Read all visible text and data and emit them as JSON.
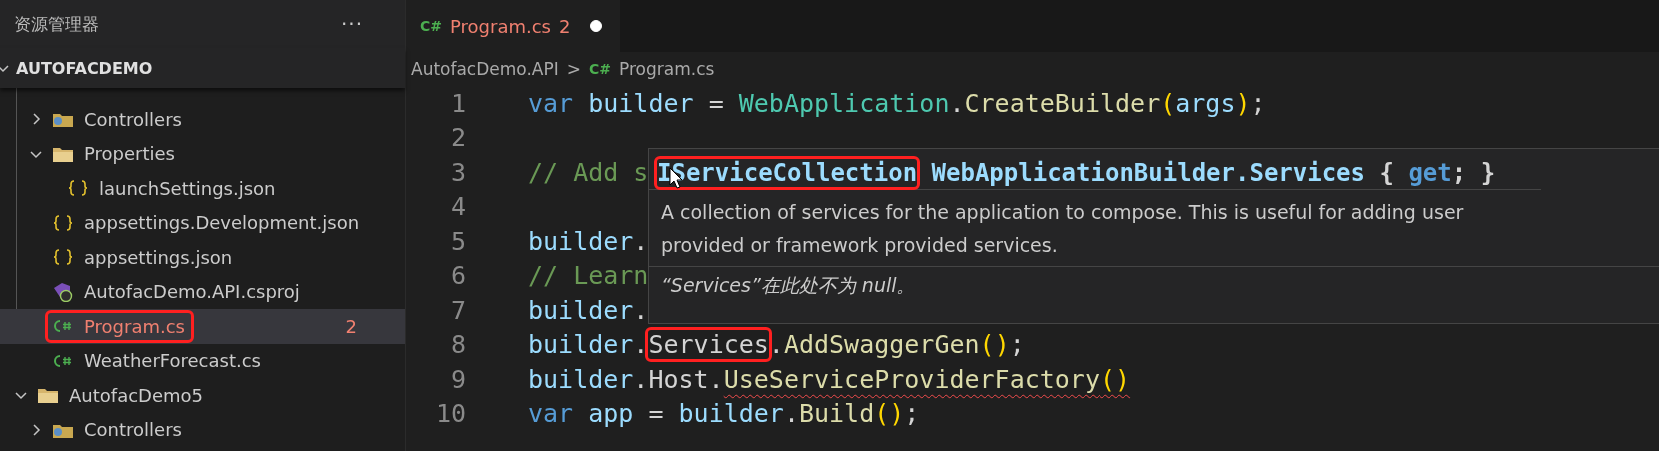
{
  "sidebar": {
    "title": "资源管理器",
    "more": "···",
    "root": {
      "label": "AUTOFACDEMO",
      "expanded": true
    },
    "items": [
      {
        "kind": "webfolder",
        "label": "Controllers",
        "expanded": false
      },
      {
        "kind": "folder",
        "label": "Properties",
        "expanded": true,
        "children": [
          {
            "kind": "json",
            "label": "launchSettings.json"
          }
        ]
      },
      {
        "kind": "json",
        "label": "appsettings.Development.json"
      },
      {
        "kind": "json",
        "label": "appsettings.json"
      },
      {
        "kind": "csproj",
        "label": "AutofacDemo.API.csproj"
      },
      {
        "kind": "csharp",
        "label": "Program.cs",
        "selected": true,
        "error": true,
        "badge": "2",
        "annotated": true
      },
      {
        "kind": "csharp",
        "label": "WeatherForecast.cs",
        "selected": false,
        "error": false,
        "annotated": false
      },
      {
        "kind": "rootfolder",
        "label": "AutofacDemo5",
        "expanded": true,
        "children": [
          {
            "kind": "webfolder",
            "label": "Controllers",
            "expanded": false
          }
        ]
      }
    ]
  },
  "tabs": [
    {
      "icon": "C#",
      "label": "Program.cs",
      "badge": "2",
      "selected": true,
      "modified": true
    }
  ],
  "breadcrumb": {
    "folder": "AutofacDemo.API",
    "separator": ">",
    "icon": "C#",
    "file": "Program.cs"
  },
  "code": [
    {
      "n": "1",
      "tokens": [
        {
          "kind": "keyword",
          "text": "var "
        },
        {
          "kind": "variable",
          "text": "builder"
        },
        {
          "kind": "plain",
          "text": " = "
        },
        {
          "kind": "type",
          "text": "WebApplication"
        },
        {
          "kind": "plain",
          "text": "."
        },
        {
          "kind": "method",
          "text": "CreateBuilder"
        },
        {
          "kind": "bracket",
          "text": "("
        },
        {
          "kind": "variable",
          "text": "args"
        },
        {
          "kind": "bracket",
          "text": ")"
        },
        {
          "kind": "plain",
          "text": ";"
        }
      ]
    },
    {
      "n": "2"
    },
    {
      "n": "3",
      "tokens": [
        {
          "kind": "comment",
          "text": "// Add s"
        }
      ]
    },
    {
      "n": "4"
    },
    {
      "n": "5",
      "tokens": [
        {
          "kind": "variable",
          "text": "builder"
        },
        {
          "kind": "plain",
          "text": "."
        }
      ]
    },
    {
      "n": "6",
      "tokens": [
        {
          "kind": "comment",
          "text": "// Learn"
        }
      ]
    },
    {
      "n": "7",
      "tokens": [
        {
          "kind": "variable",
          "text": "builder"
        },
        {
          "kind": "plain",
          "text": "."
        }
      ]
    },
    {
      "n": "8",
      "tokens": [
        {
          "kind": "variable",
          "text": "builder"
        },
        {
          "kind": "plain",
          "text": "."
        },
        {
          "kind": "plain",
          "text": "Services",
          "annotated": true
        },
        {
          "kind": "plain",
          "text": "."
        },
        {
          "kind": "method",
          "text": "AddSwaggerGen"
        },
        {
          "kind": "bracket",
          "text": "()"
        },
        {
          "kind": "plain",
          "text": ";"
        }
      ]
    },
    {
      "n": "9",
      "tokens": [
        {
          "kind": "variable",
          "text": "builder"
        },
        {
          "kind": "plain",
          "text": ".Host."
        },
        {
          "kind": "method",
          "text": "UseServiceProviderFactory",
          "error": true
        },
        {
          "kind": "bracket",
          "text": "()",
          "error": true
        }
      ]
    },
    {
      "n": "10",
      "tokens": [
        {
          "kind": "keyword",
          "text": "var "
        },
        {
          "kind": "variable",
          "text": "app"
        },
        {
          "kind": "plain",
          "text": " = "
        },
        {
          "kind": "variable",
          "text": "builder"
        },
        {
          "kind": "plain",
          "text": "."
        },
        {
          "kind": "method",
          "text": "Build"
        },
        {
          "kind": "bracket",
          "text": "()"
        },
        {
          "kind": "plain",
          "text": ";"
        }
      ]
    }
  ],
  "hover": {
    "signature": [
      {
        "kind": "type",
        "text": "IServiceCollection",
        "annotated": true
      },
      {
        "kind": "type",
        "text": " WebApplicationBuilder.Services"
      },
      {
        "kind": "plain",
        "text": " { "
      },
      {
        "kind": "keyword",
        "text": "get"
      },
      {
        "kind": "plain",
        "text": "; }"
      }
    ],
    "description": "A collection of services for the application to compose. This is useful for adding user provided or framework provided services.",
    "note": "“Services”在此处不为 null。"
  }
}
